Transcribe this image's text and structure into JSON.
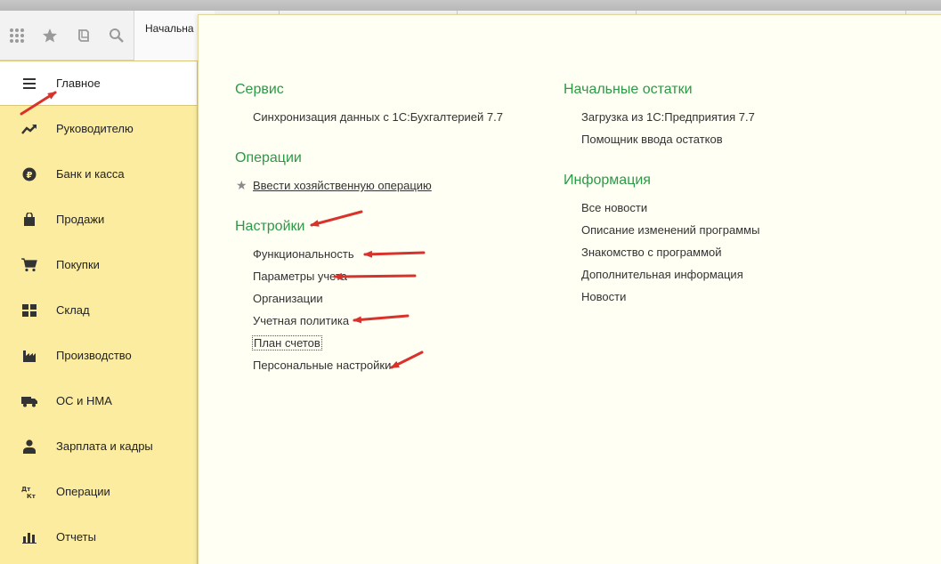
{
  "toolbar": {
    "icons": [
      "apps-grid-icon",
      "favorites-star-icon",
      "history-icon",
      "search-icon"
    ],
    "tab_home_label": "Начальна"
  },
  "sidebar": {
    "items": [
      {
        "label": "Главное",
        "icon": "menu-icon",
        "active": true
      },
      {
        "label": "Руководителю",
        "icon": "trend-icon"
      },
      {
        "label": "Банк и касса",
        "icon": "ruble-icon"
      },
      {
        "label": "Продажи",
        "icon": "bag-icon"
      },
      {
        "label": "Покупки",
        "icon": "cart-icon"
      },
      {
        "label": "Склад",
        "icon": "warehouse-icon"
      },
      {
        "label": "Производство",
        "icon": "factory-icon"
      },
      {
        "label": "ОС и НМА",
        "icon": "truck-icon"
      },
      {
        "label": "Зарплата и кадры",
        "icon": "person-icon"
      },
      {
        "label": "Операции",
        "icon": "dt-kt-icon"
      },
      {
        "label": "Отчеты",
        "icon": "bar-chart-icon"
      }
    ]
  },
  "main": {
    "service": {
      "title": "Сервис",
      "links": [
        "Синхронизация данных с 1С:Бухгалтерией 7.7"
      ]
    },
    "operations": {
      "title": "Операции",
      "links": [
        "Ввести хозяйственную операцию"
      ]
    },
    "settings": {
      "title": "Настройки",
      "links": [
        "Функциональность",
        "Параметры учета",
        "Организации",
        "Учетная политика",
        "План счетов",
        "Персональные настройки"
      ]
    },
    "initial_balances": {
      "title": "Начальные остатки",
      "links": [
        "Загрузка из 1С:Предприятия 7.7",
        "Помощник ввода остатков"
      ]
    },
    "information": {
      "title": "Информация",
      "links": [
        "Все новости",
        "Описание изменений программы",
        "Знакомство с программой",
        "Дополнительная информация",
        "Новости"
      ]
    }
  },
  "colors": {
    "sidebar_bg": "#fbeca0",
    "panel_bg": "#fffff4",
    "section_title": "#2a9a46",
    "annotation_arrow": "#d8322b"
  }
}
